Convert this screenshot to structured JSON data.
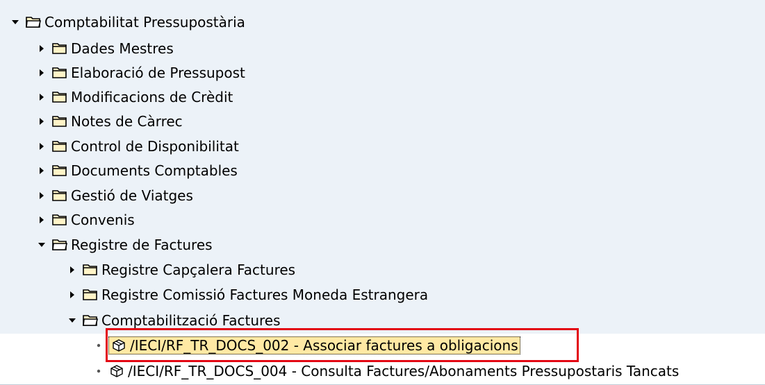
{
  "tree": {
    "root": {
      "label": "Comptabilitat Pressupostària",
      "expanded": true
    },
    "level1_items": [
      {
        "label": "Dades Mestres",
        "expanded": false
      },
      {
        "label": "Elaboració de Pressupost",
        "expanded": false
      },
      {
        "label": "Modificacions de Crèdit",
        "expanded": false
      },
      {
        "label": "Notes de Càrrec",
        "expanded": false
      },
      {
        "label": "Control de Disponibilitat",
        "expanded": false
      },
      {
        "label": "Documents Comptables",
        "expanded": false
      },
      {
        "label": "Gestió de Viatges",
        "expanded": false
      },
      {
        "label": "Convenis",
        "expanded": false
      },
      {
        "label": "Registre de Factures",
        "expanded": true
      }
    ],
    "level2_items": [
      {
        "label": "Registre Capçalera Factures",
        "expanded": false
      },
      {
        "label": "Registre Comissió Factures Moneda Estrangera",
        "expanded": false
      },
      {
        "label": "Comptabilització Factures",
        "expanded": true
      }
    ],
    "level3_items": [
      {
        "label": "/IECI/RF_TR_DOCS_002 - Associar factures a obligacions",
        "selected": true
      },
      {
        "label": "/IECI/RF_TR_DOCS_004 - Consulta Factures/Abonaments Pressupostaris Tancats",
        "selected": false
      }
    ]
  },
  "colors": {
    "highlight_border": "#e30613",
    "selected_background": "#ffe9a4",
    "band_background": "#ecf2f8",
    "folder_fill": "#fff4c7"
  },
  "icons": {
    "expand": "triangle-right",
    "collapse": "triangle-down",
    "folder_closed": "folder-icon",
    "folder_open": "folder-open-icon",
    "transaction": "transaction-cube-icon"
  }
}
